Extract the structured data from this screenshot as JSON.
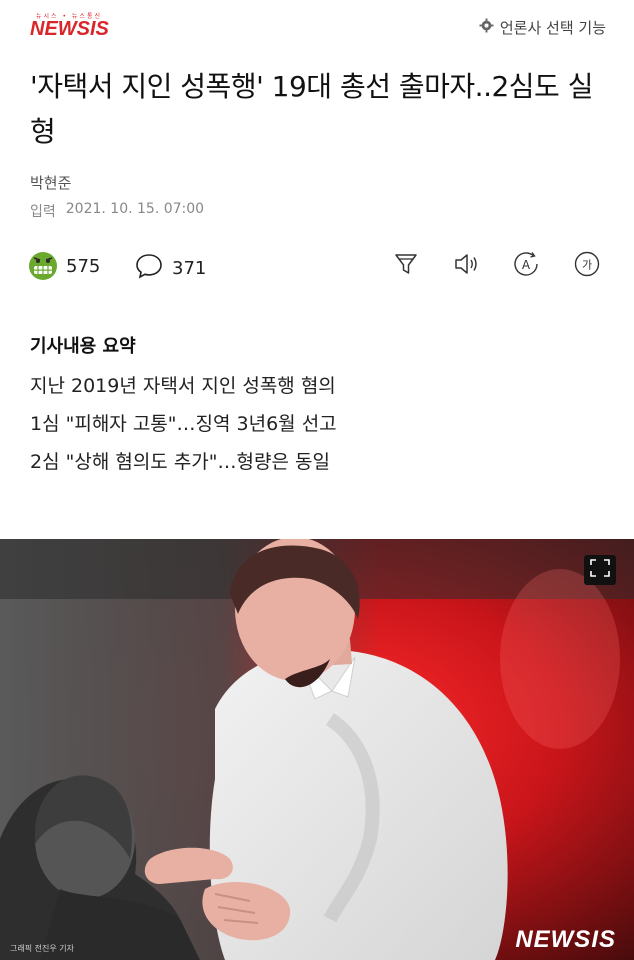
{
  "header": {
    "logo_sub": "뉴시스 • 뉴스통신",
    "logo_text": "NEWSIS",
    "press_select_label": "언론사 선택 기능",
    "press_select_icon": "gear-icon"
  },
  "article": {
    "title": "'자택서 지인 성폭행' 19대 총선 출마자..2심도 실형",
    "reporter": "박현준",
    "date_label": "입력",
    "date_value": "2021. 10. 15. 07:00"
  },
  "actions": {
    "reaction_count": "575",
    "comment_count": "371",
    "tools": [
      "filter-icon",
      "speaker-icon",
      "translate-icon",
      "font-size-icon"
    ],
    "font_size_glyph": "가",
    "translate_glyph": "A"
  },
  "summary": {
    "heading": "기사내용 요약",
    "items": [
      "지난 2019년 자택서 지인 성폭행 혐의",
      "1심 \"피해자 고통\"…징역 3년6월 선고",
      "2심 \"상해 혐의도 추가\"…형량은 동일"
    ]
  },
  "image": {
    "credit": "그래픽 전진우 기자",
    "watermark": "NEWSIS",
    "expand_icon": "expand-icon"
  },
  "colors": {
    "brand_red": "#d9262b",
    "text": "#111111",
    "muted": "#888888"
  }
}
